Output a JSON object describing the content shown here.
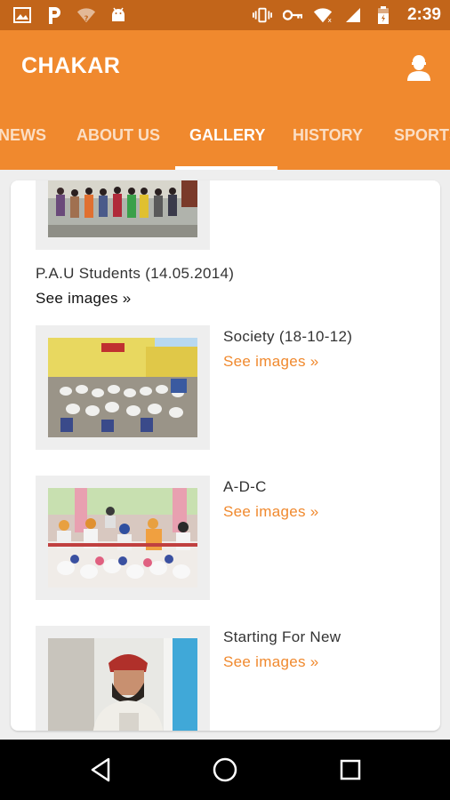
{
  "status_bar": {
    "time": "2:39",
    "left_icons": [
      "image-icon",
      "p-app-icon",
      "wifi-unknown-icon",
      "android-icon"
    ],
    "right_icons": [
      "vibrate-icon",
      "key-icon",
      "wifi-icon",
      "signal-icon",
      "battery-icon"
    ]
  },
  "app_bar": {
    "title": "CHAKAR",
    "color": "#f0892e"
  },
  "tabs": [
    {
      "label": "NEWS"
    },
    {
      "label": "ABOUT US"
    },
    {
      "label": "GALLERY",
      "active": true
    },
    {
      "label": "HISTORY"
    },
    {
      "label": "SPORTS"
    }
  ],
  "gallery": {
    "items": [
      {
        "title": "P.A.U Students (14.05.2014)",
        "link": "See images »"
      },
      {
        "title": "Society (18-10-12)",
        "link": "See images »"
      },
      {
        "title": "A-D-C",
        "link": "See images »"
      },
      {
        "title": "Starting For New",
        "link": "See images »"
      }
    ]
  },
  "nav_bar": {
    "icons": [
      "back-icon",
      "home-icon",
      "recents-icon"
    ]
  }
}
